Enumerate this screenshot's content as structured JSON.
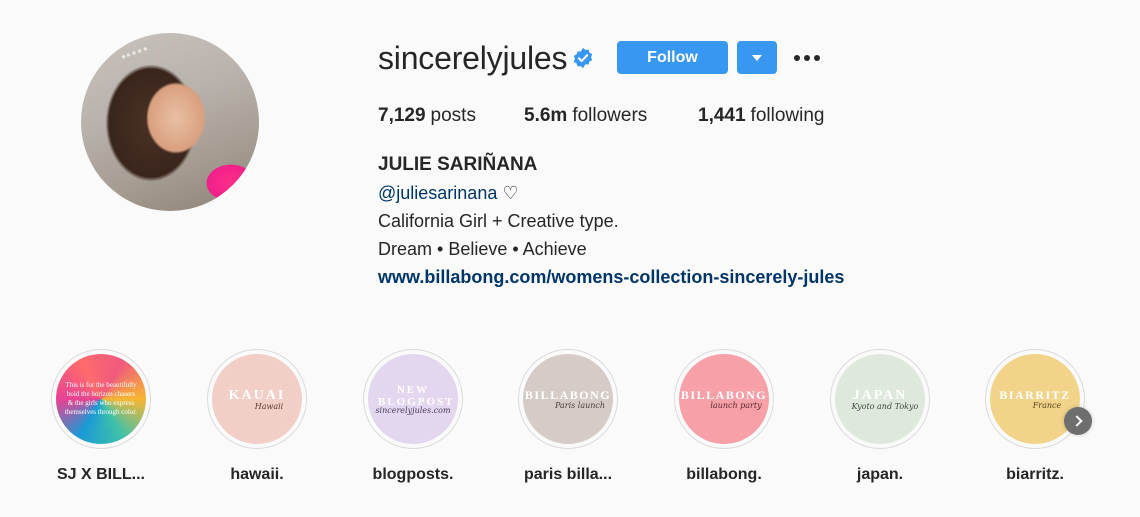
{
  "profile": {
    "username": "sincerelyjules",
    "verified_icon": "verified-badge-icon",
    "follow_label": "Follow",
    "accent_color": "#3897f0"
  },
  "stats": {
    "posts_count": "7,129",
    "posts_label": "posts",
    "followers_count": "5.6m",
    "followers_label": "followers",
    "following_count": "1,441",
    "following_label": "following"
  },
  "bio": {
    "full_name": "JULIE SARIÑANA",
    "mention": "@juliesarinana",
    "heart": "♡",
    "line1": "California Girl + Creative type.",
    "line2": "Dream • Believe • Achieve",
    "website": "www.billabong.com/womens-collection-sincerely-jules"
  },
  "highlights": [
    {
      "label": "SJ X BILL...",
      "cover_text": "This is for the beautifully bold the horizon chasers & the girls who express themselves through color."
    },
    {
      "label": "hawaii.",
      "cover_title": "KAUAI",
      "cover_script": "Hawaii"
    },
    {
      "label": "blogposts.",
      "cover_title": "NEW BLOGPOST",
      "cover_script": "sincerelyjules.com"
    },
    {
      "label": "paris billa...",
      "cover_title": "BILLABONG",
      "cover_script": "Paris launch"
    },
    {
      "label": "billabong.",
      "cover_title": "BILLABONG",
      "cover_script": "launch party"
    },
    {
      "label": "japan.",
      "cover_title": "JAPAN",
      "cover_script": "Kyoto and Tokyo"
    },
    {
      "label": "biarritz.",
      "cover_title": "BIARRITZ",
      "cover_script": "France"
    }
  ]
}
